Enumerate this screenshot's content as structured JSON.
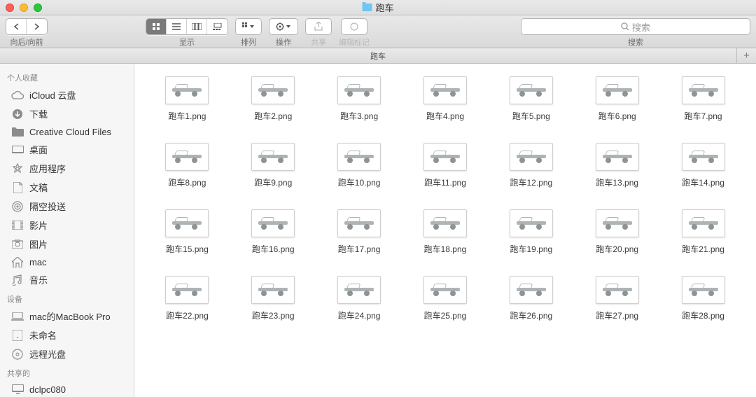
{
  "window": {
    "title": "跑车"
  },
  "toolbar": {
    "nav_label": "向后/向前",
    "view_label": "显示",
    "arrange_label": "排列",
    "action_label": "操作",
    "share_label": "共享",
    "tags_label": "编辑标记",
    "search_label": "搜索",
    "search_placeholder": "搜索"
  },
  "pathbar": {
    "current": "跑车"
  },
  "sidebar": {
    "sections": [
      {
        "header": "个人收藏",
        "items": [
          {
            "icon": "cloud",
            "label": "iCloud 云盘"
          },
          {
            "icon": "download",
            "label": "下载"
          },
          {
            "icon": "folder",
            "label": "Creative Cloud Files"
          },
          {
            "icon": "desktop",
            "label": "桌面"
          },
          {
            "icon": "apps",
            "label": "应用程序"
          },
          {
            "icon": "doc",
            "label": "文稿"
          },
          {
            "icon": "airdrop",
            "label": "隔空投送"
          },
          {
            "icon": "movies",
            "label": "影片"
          },
          {
            "icon": "pictures",
            "label": "图片"
          },
          {
            "icon": "home",
            "label": "mac"
          },
          {
            "icon": "music",
            "label": "音乐"
          }
        ]
      },
      {
        "header": "设备",
        "items": [
          {
            "icon": "laptop",
            "label": "mac的MacBook Pro"
          },
          {
            "icon": "disk",
            "label": "未命名"
          },
          {
            "icon": "disc",
            "label": "远程光盘"
          }
        ]
      },
      {
        "header": "共享的",
        "items": [
          {
            "icon": "screen",
            "label": "dclpc080"
          }
        ]
      }
    ]
  },
  "files": [
    {
      "name": "跑车1.png"
    },
    {
      "name": "跑车2.png"
    },
    {
      "name": "跑车3.png"
    },
    {
      "name": "跑车4.png"
    },
    {
      "name": "跑车5.png"
    },
    {
      "name": "跑车6.png"
    },
    {
      "name": "跑车7.png"
    },
    {
      "name": "跑车8.png"
    },
    {
      "name": "跑车9.png"
    },
    {
      "name": "跑车10.png"
    },
    {
      "name": "跑车11.png"
    },
    {
      "name": "跑车12.png"
    },
    {
      "name": "跑车13.png"
    },
    {
      "name": "跑车14.png"
    },
    {
      "name": "跑车15.png"
    },
    {
      "name": "跑车16.png"
    },
    {
      "name": "跑车17.png"
    },
    {
      "name": "跑车18.png"
    },
    {
      "name": "跑车19.png"
    },
    {
      "name": "跑车20.png"
    },
    {
      "name": "跑车21.png"
    },
    {
      "name": "跑车22.png"
    },
    {
      "name": "跑车23.png"
    },
    {
      "name": "跑车24.png"
    },
    {
      "name": "跑车25.png"
    },
    {
      "name": "跑车26.png"
    },
    {
      "name": "跑车27.png"
    },
    {
      "name": "跑车28.png"
    }
  ]
}
